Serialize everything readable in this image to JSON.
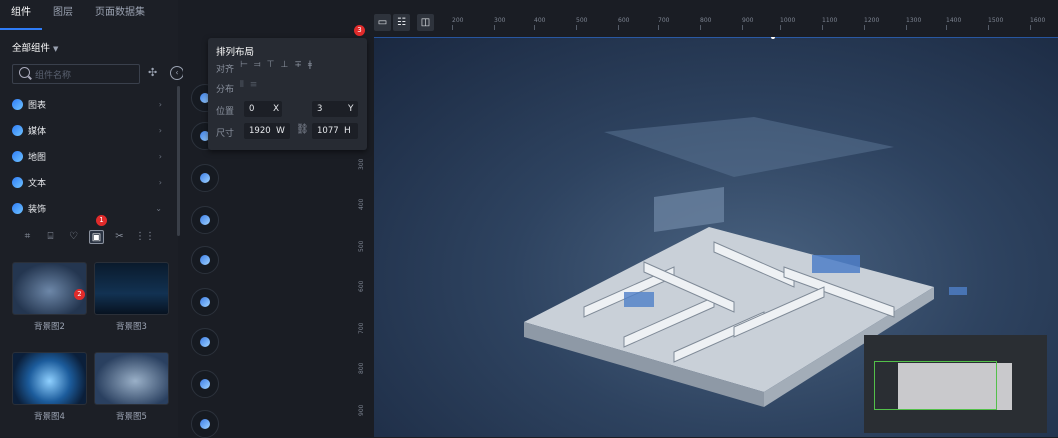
{
  "tabs": [
    "组件",
    "图层",
    "页面数据集"
  ],
  "category_title": "全部组件",
  "search": {
    "placeholder": "组件名称"
  },
  "categories": [
    "图表",
    "媒体",
    "地图",
    "文本",
    "装饰"
  ],
  "type_icons": [
    "frame-icon",
    "border-icon",
    "heart-icon",
    "image-icon",
    "scissors-icon",
    "grid-icon"
  ],
  "badges": [
    "1",
    "2",
    "3"
  ],
  "thumbnails": [
    "背景图2",
    "背景图3",
    "背景图4",
    "背景图5"
  ],
  "popup": {
    "title": "排列布局",
    "align_label": "对齐",
    "distribute_label": "分布",
    "position_label": "位置",
    "size_label": "尺寸",
    "x_val": "0",
    "x_unit": "X",
    "y_val": "3",
    "y_unit": "Y",
    "w_val": "1920",
    "w_unit": "W",
    "h_val": "1077",
    "h_unit": "H"
  },
  "ruler_top": [
    "200",
    "300",
    "400",
    "500",
    "600",
    "700",
    "800",
    "900",
    "1000",
    "1100",
    "1200",
    "1300",
    "1400",
    "1500",
    "1600"
  ],
  "ruler_left": [
    "300",
    "400",
    "500",
    "600",
    "700",
    "800",
    "900"
  ],
  "colors": {
    "accent": "#2f7cf6",
    "badge": "#e02b2b",
    "minimap_frame": "#53c04a"
  }
}
